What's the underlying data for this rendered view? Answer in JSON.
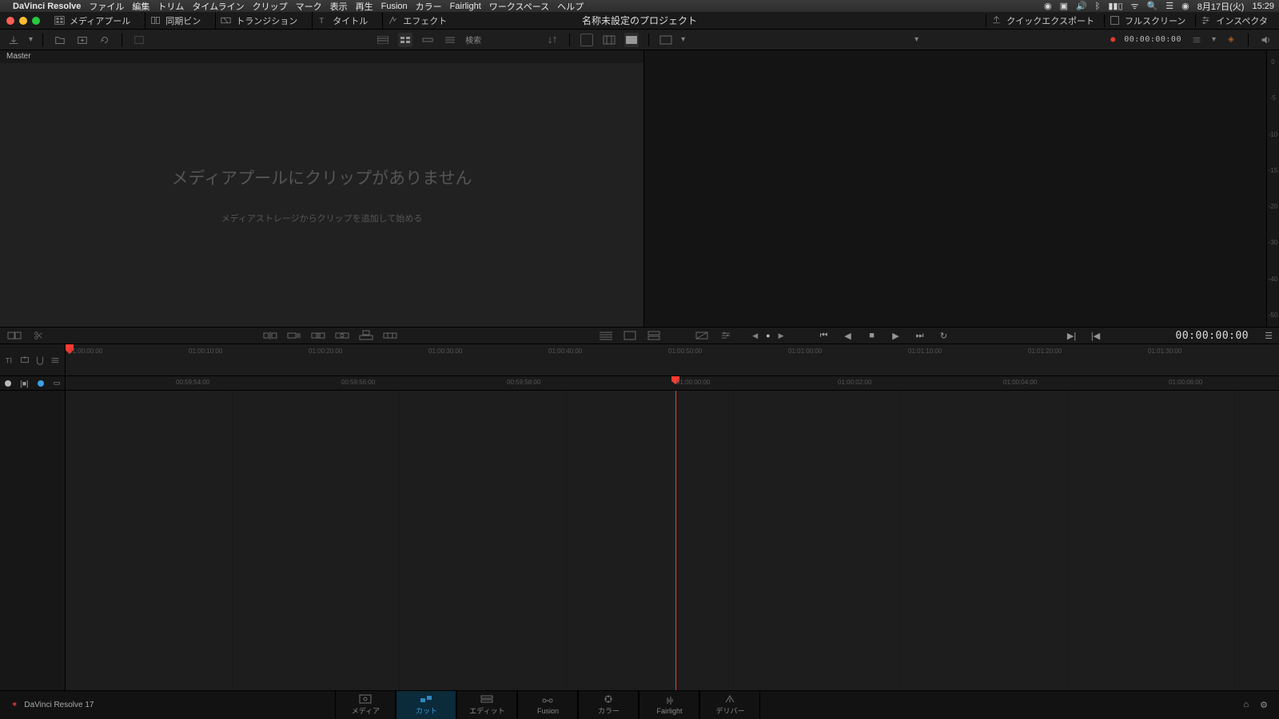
{
  "mac_menu": {
    "app": "DaVinci Resolve",
    "items": [
      "ファイル",
      "編集",
      "トリム",
      "タイムライン",
      "クリップ",
      "マーク",
      "表示",
      "再生",
      "Fusion",
      "カラー",
      "Fairlight",
      "ワークスペース",
      "ヘルプ"
    ],
    "right": {
      "date": "8月17日(火)",
      "time": "15:29"
    }
  },
  "app_bar": {
    "tabs": [
      "メディアプール",
      "同期ビン",
      "トランジション",
      "タイトル",
      "エフェクト"
    ],
    "title": "名称未設定のプロジェクト",
    "right": [
      "クイックエクスポート",
      "フルスクリーン",
      "インスペクタ"
    ]
  },
  "toolbar2": {
    "search": "検索",
    "timecode": "00:00:00:00"
  },
  "mediapool": {
    "breadcrumb": "Master",
    "empty_big": "メディアプールにクリップがありません",
    "empty_sub": "メディアストレージからクリップを追加して始める"
  },
  "audiometer": [
    "0",
    "-5",
    "-10",
    "-15",
    "-20",
    "-30",
    "-40",
    "-50"
  ],
  "midbar": {
    "timecode": "00:00:00:00"
  },
  "ruler_upper": [
    "01:00:00:00",
    "01:00:10:00",
    "01:00:20:00",
    "01:00:30:00",
    "01:00:40:00",
    "01:00:50:00",
    "01:01:00:00",
    "01:01:10:00",
    "01:01:20:00",
    "01:01:30:00"
  ],
  "ruler_lower": [
    "00:59:54:00",
    "00:59:56:00",
    "00:59:58:00",
    "01:00:00:00",
    "01:00:02:00",
    "01:00:04:00",
    "01:00:06:00"
  ],
  "pages": [
    "メディア",
    "カット",
    "エディット",
    "Fusion",
    "カラー",
    "Fairlight",
    "デリバー"
  ],
  "status": "DaVinci Resolve 17"
}
